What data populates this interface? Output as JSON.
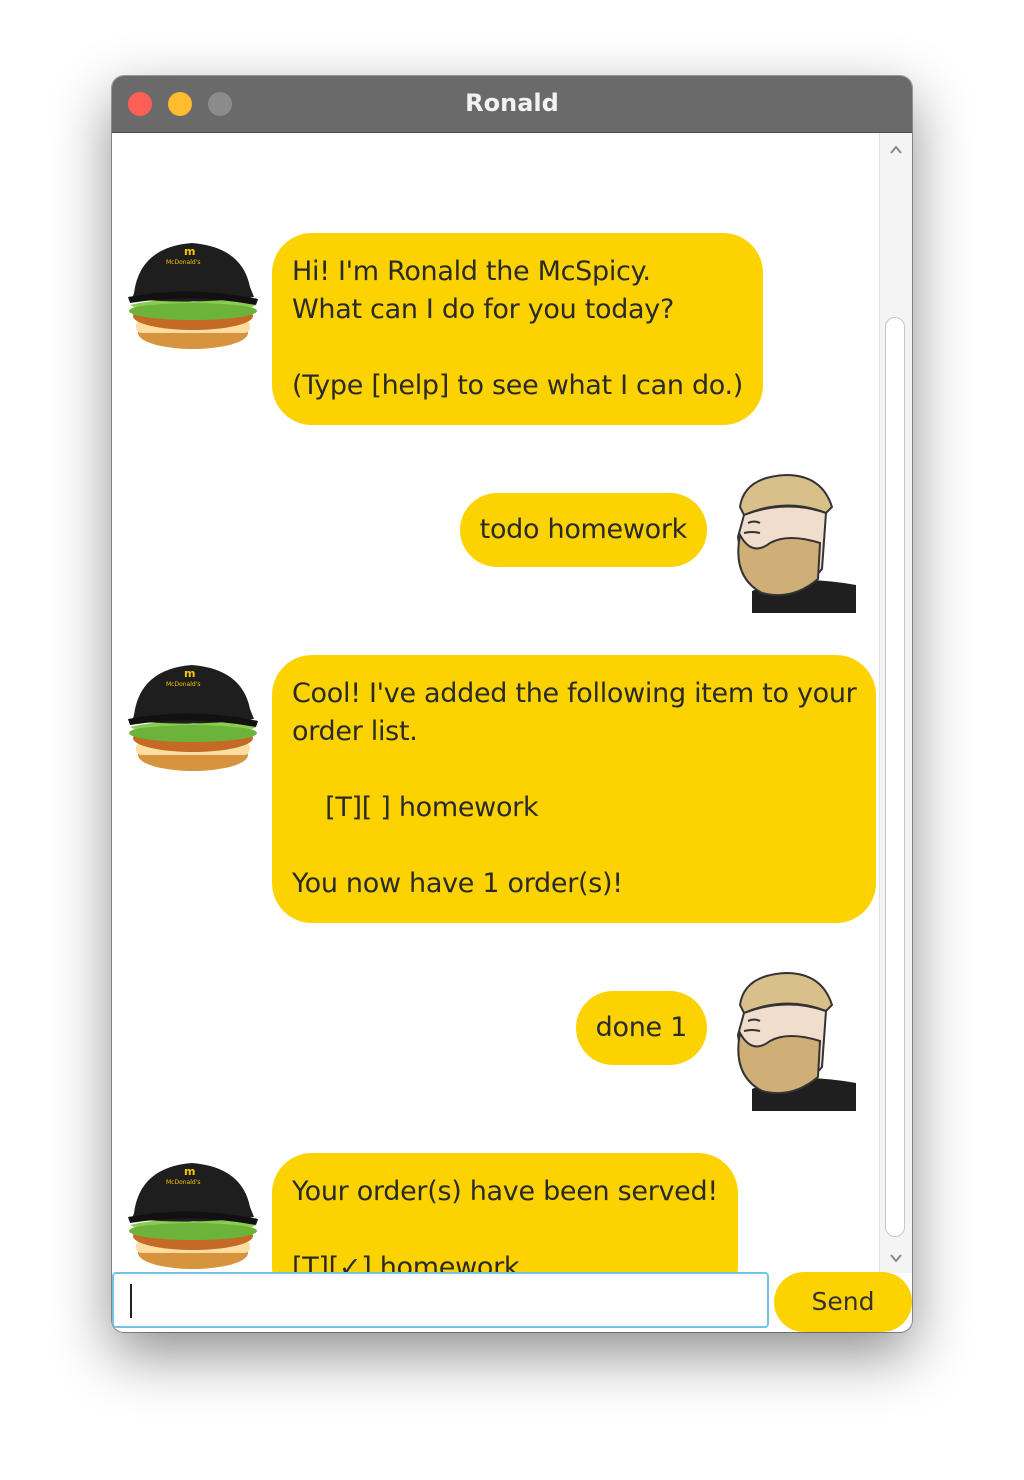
{
  "window": {
    "title": "Ronald"
  },
  "messages": [
    {
      "sender": "bot",
      "text": "Hi! I'm Ronald the McSpicy.\nWhat can I do for you today?\n\n(Type [help] to see what I can do.)"
    },
    {
      "sender": "user",
      "text": "todo homework"
    },
    {
      "sender": "bot",
      "text": "Cool! I've added the following item to your\norder list.\n\n    [T][ ] homework\n\nYou now have 1 order(s)!"
    },
    {
      "sender": "user",
      "text": "done 1"
    },
    {
      "sender": "bot",
      "text": "Your order(s) have been served!\n\n[T][✓] homework"
    }
  ],
  "input": {
    "value": "",
    "placeholder": ""
  },
  "send_button": {
    "label": "Send"
  },
  "colors": {
    "bubble": "#fcd300",
    "titlebar": "#6a6a6a",
    "input_focus": "#74c1e8"
  },
  "icons": {
    "bot_avatar": "burger-with-cap-icon",
    "user_avatar": "bearded-man-icon"
  }
}
